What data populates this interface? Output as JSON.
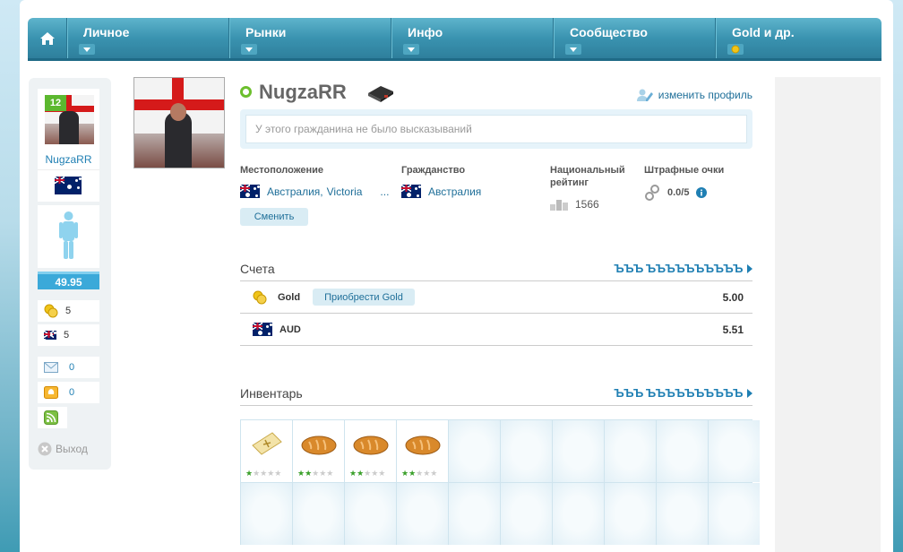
{
  "nav": {
    "items": [
      {
        "label": "Личное"
      },
      {
        "label": "Рынки"
      },
      {
        "label": "Инфо"
      },
      {
        "label": "Сообщество"
      },
      {
        "label": "Gold и др."
      }
    ]
  },
  "sidebar": {
    "level": "12",
    "username": "NugzaRR",
    "strength": "49.95",
    "gold": "5",
    "currency": "5",
    "messages": "0",
    "alerts": "0",
    "logout": "Выход"
  },
  "profile": {
    "name": "NugzaRR",
    "edit": "изменить профиль",
    "status_placeholder": "У этого гражданина не было высказываний",
    "location_label": "Местоположение",
    "location_country": "Австралия,",
    "location_region": "Victoria",
    "location_more": "...",
    "citizenship_label": "Гражданство",
    "citizenship_value": "Австралия",
    "rank_label_1": "Национальный",
    "rank_label_2": "рейтинг",
    "rank_value": "1566",
    "penalty_label": "Штрафные очки",
    "penalty_value": "0.0/5",
    "change_button": "Сменить"
  },
  "accounts": {
    "title": "Счета",
    "link": "ЪЪЪ ЪЪЪЪЪЪЪЪЪЪ",
    "rows": [
      {
        "currency": "Gold",
        "button": "Приобрести Gold",
        "amount": "5.00"
      },
      {
        "currency": "AUD",
        "amount": "5.51"
      }
    ]
  },
  "inventory": {
    "title": "Инвентарь",
    "link": "ЪЪЪ ЪЪЪЪЪЪЪЪЪЪ",
    "items": [
      {
        "icon": "ticket-icon",
        "quality": 1
      },
      {
        "icon": "bread-icon",
        "quality": 2
      },
      {
        "icon": "bread-icon",
        "quality": 2
      },
      {
        "icon": "bread-icon",
        "quality": 2
      }
    ]
  }
}
